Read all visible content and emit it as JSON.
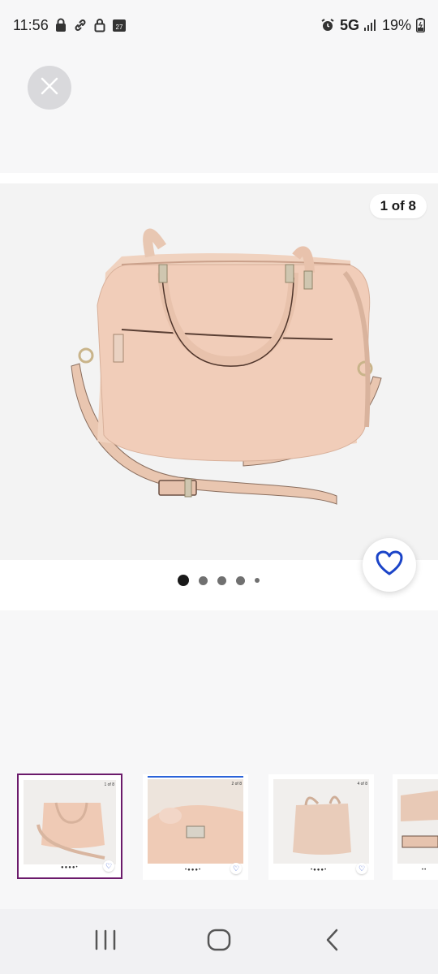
{
  "status_bar": {
    "time": "11:56",
    "calendar_day": "27",
    "network": "5G",
    "battery": "19%"
  },
  "gallery": {
    "counter": "1 of 8",
    "dot_count": 5,
    "active_dot": 0
  },
  "thumbnails": [
    {
      "counter": "1 of 8",
      "selected": true
    },
    {
      "counter": "2 of 8",
      "selected": false
    },
    {
      "counter": "4 of 8",
      "selected": false
    },
    {
      "counter": "",
      "selected": false
    }
  ],
  "colors": {
    "accent_heart": "#1b44c8",
    "selected_border": "#6b1a6b",
    "bag": "#efcdb8"
  },
  "icons": [
    "close-icon",
    "heart-icon",
    "recent-apps-icon",
    "home-icon",
    "back-icon"
  ]
}
